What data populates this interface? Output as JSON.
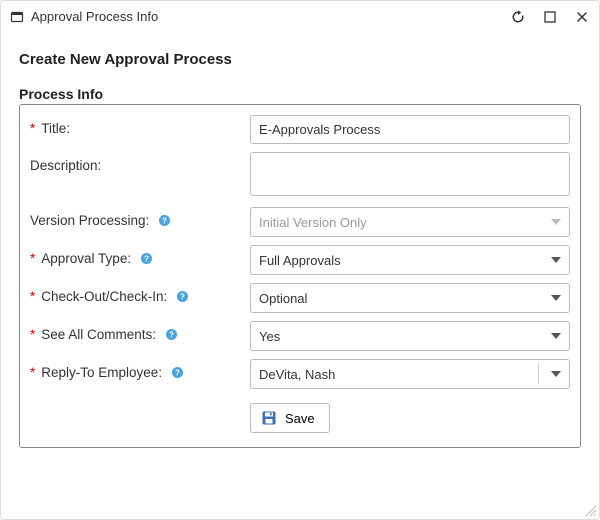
{
  "window": {
    "title": "Approval Process Info"
  },
  "page": {
    "heading": "Create New Approval Process",
    "section_label": "Process Info"
  },
  "fields": {
    "title": {
      "label": "Title:",
      "value": "E-Approvals Process"
    },
    "description": {
      "label": "Description:",
      "value": ""
    },
    "version_processing": {
      "label": "Version Processing:",
      "value": "Initial Version Only",
      "disabled": true
    },
    "approval_type": {
      "label": "Approval Type:",
      "value": "Full Approvals"
    },
    "check": {
      "label": "Check-Out/Check-In:",
      "value": "Optional"
    },
    "see_all": {
      "label": "See All Comments:",
      "value": "Yes"
    },
    "reply_to": {
      "label": "Reply-To Employee:",
      "value": "DeVita, Nash"
    }
  },
  "buttons": {
    "save": "Save"
  }
}
